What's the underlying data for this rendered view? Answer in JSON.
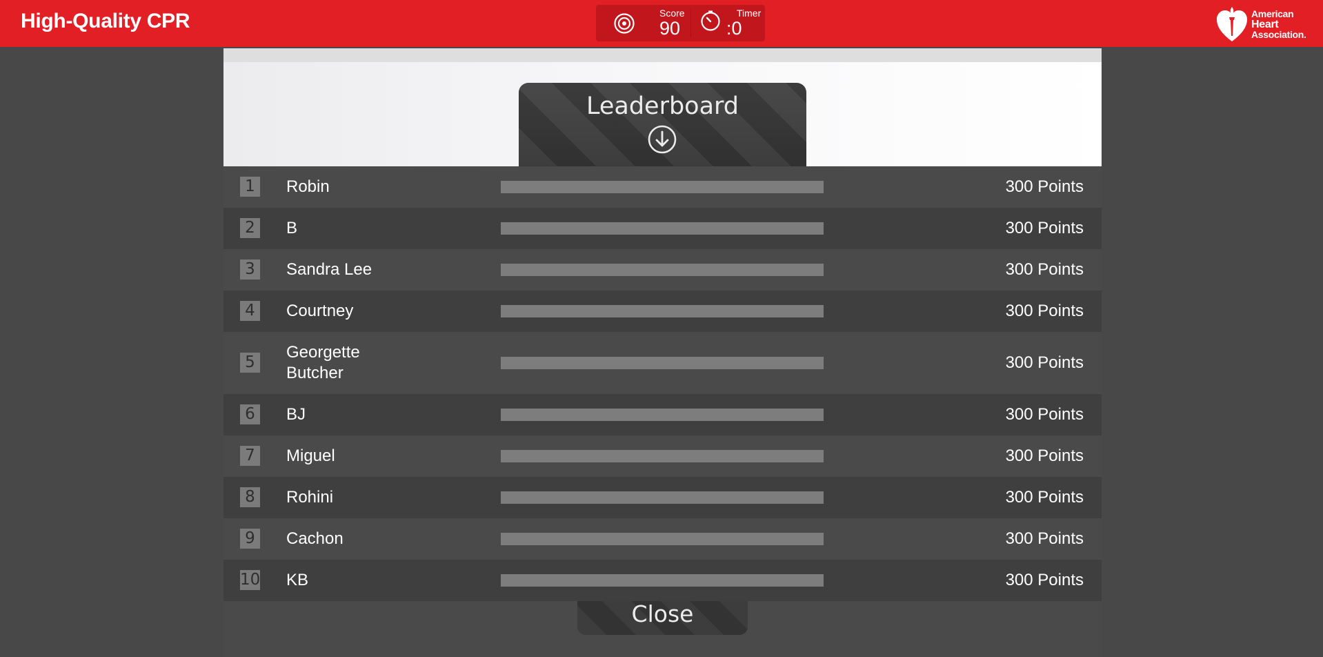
{
  "header": {
    "title": "High-Quality CPR",
    "brand_color": "#e31f26"
  },
  "hud": {
    "score_icon": "target-icon",
    "score_label": "Score",
    "score_value": "90",
    "timer_icon": "stopwatch-icon",
    "timer_label": "Timer",
    "timer_value": ":0"
  },
  "logo": {
    "icon": "heart-torch-icon",
    "line1": "American",
    "line2": "Heart",
    "line3": "Association."
  },
  "leaderboard": {
    "title": "Leaderboard",
    "title_icon": "arrow-down-circle-icon",
    "close_label": "Close",
    "entries": [
      {
        "rank": "1",
        "name": "Robin",
        "points": "300 Points",
        "progress": 1.0
      },
      {
        "rank": "2",
        "name": "B",
        "points": "300 Points",
        "progress": 1.0
      },
      {
        "rank": "3",
        "name": "Sandra Lee",
        "points": "300 Points",
        "progress": 1.0
      },
      {
        "rank": "4",
        "name": "Courtney",
        "points": "300 Points",
        "progress": 1.0
      },
      {
        "rank": "5",
        "name": "Georgette Butcher",
        "points": "300 Points",
        "progress": 1.0
      },
      {
        "rank": "6",
        "name": "BJ",
        "points": "300 Points",
        "progress": 1.0
      },
      {
        "rank": "7",
        "name": "Miguel",
        "points": "300 Points",
        "progress": 1.0
      },
      {
        "rank": "8",
        "name": "Rohini",
        "points": "300 Points",
        "progress": 1.0
      },
      {
        "rank": "9",
        "name": "Cachon",
        "points": "300 Points",
        "progress": 1.0
      },
      {
        "rank": "10",
        "name": "KB",
        "points": "300 Points",
        "progress": 1.0
      }
    ]
  }
}
